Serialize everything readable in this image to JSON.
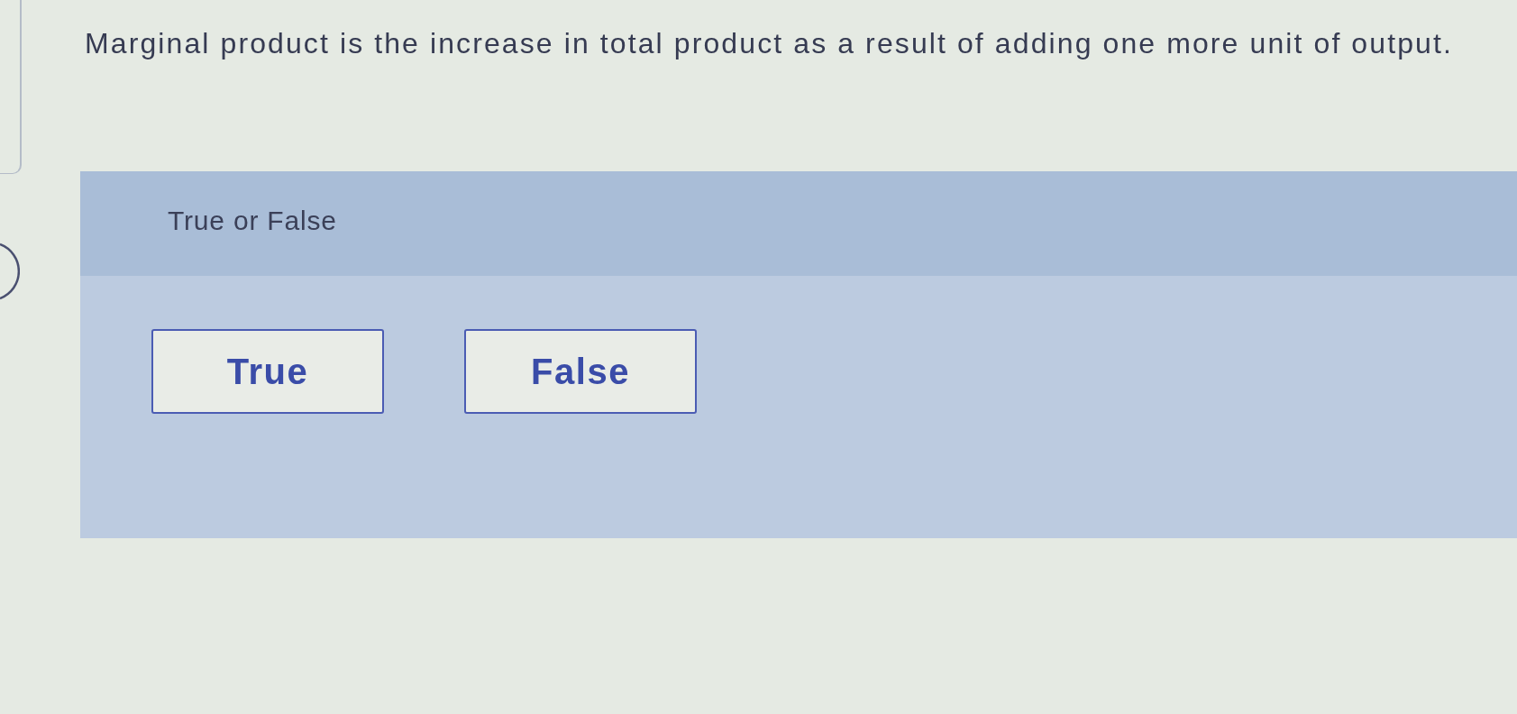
{
  "question": {
    "text": "Marginal product is the increase in total product as a result of adding one more unit of output."
  },
  "answer_panel": {
    "prompt": "True or False",
    "options": [
      {
        "label": "True",
        "selected": false
      },
      {
        "label": "False",
        "selected": false
      }
    ]
  }
}
